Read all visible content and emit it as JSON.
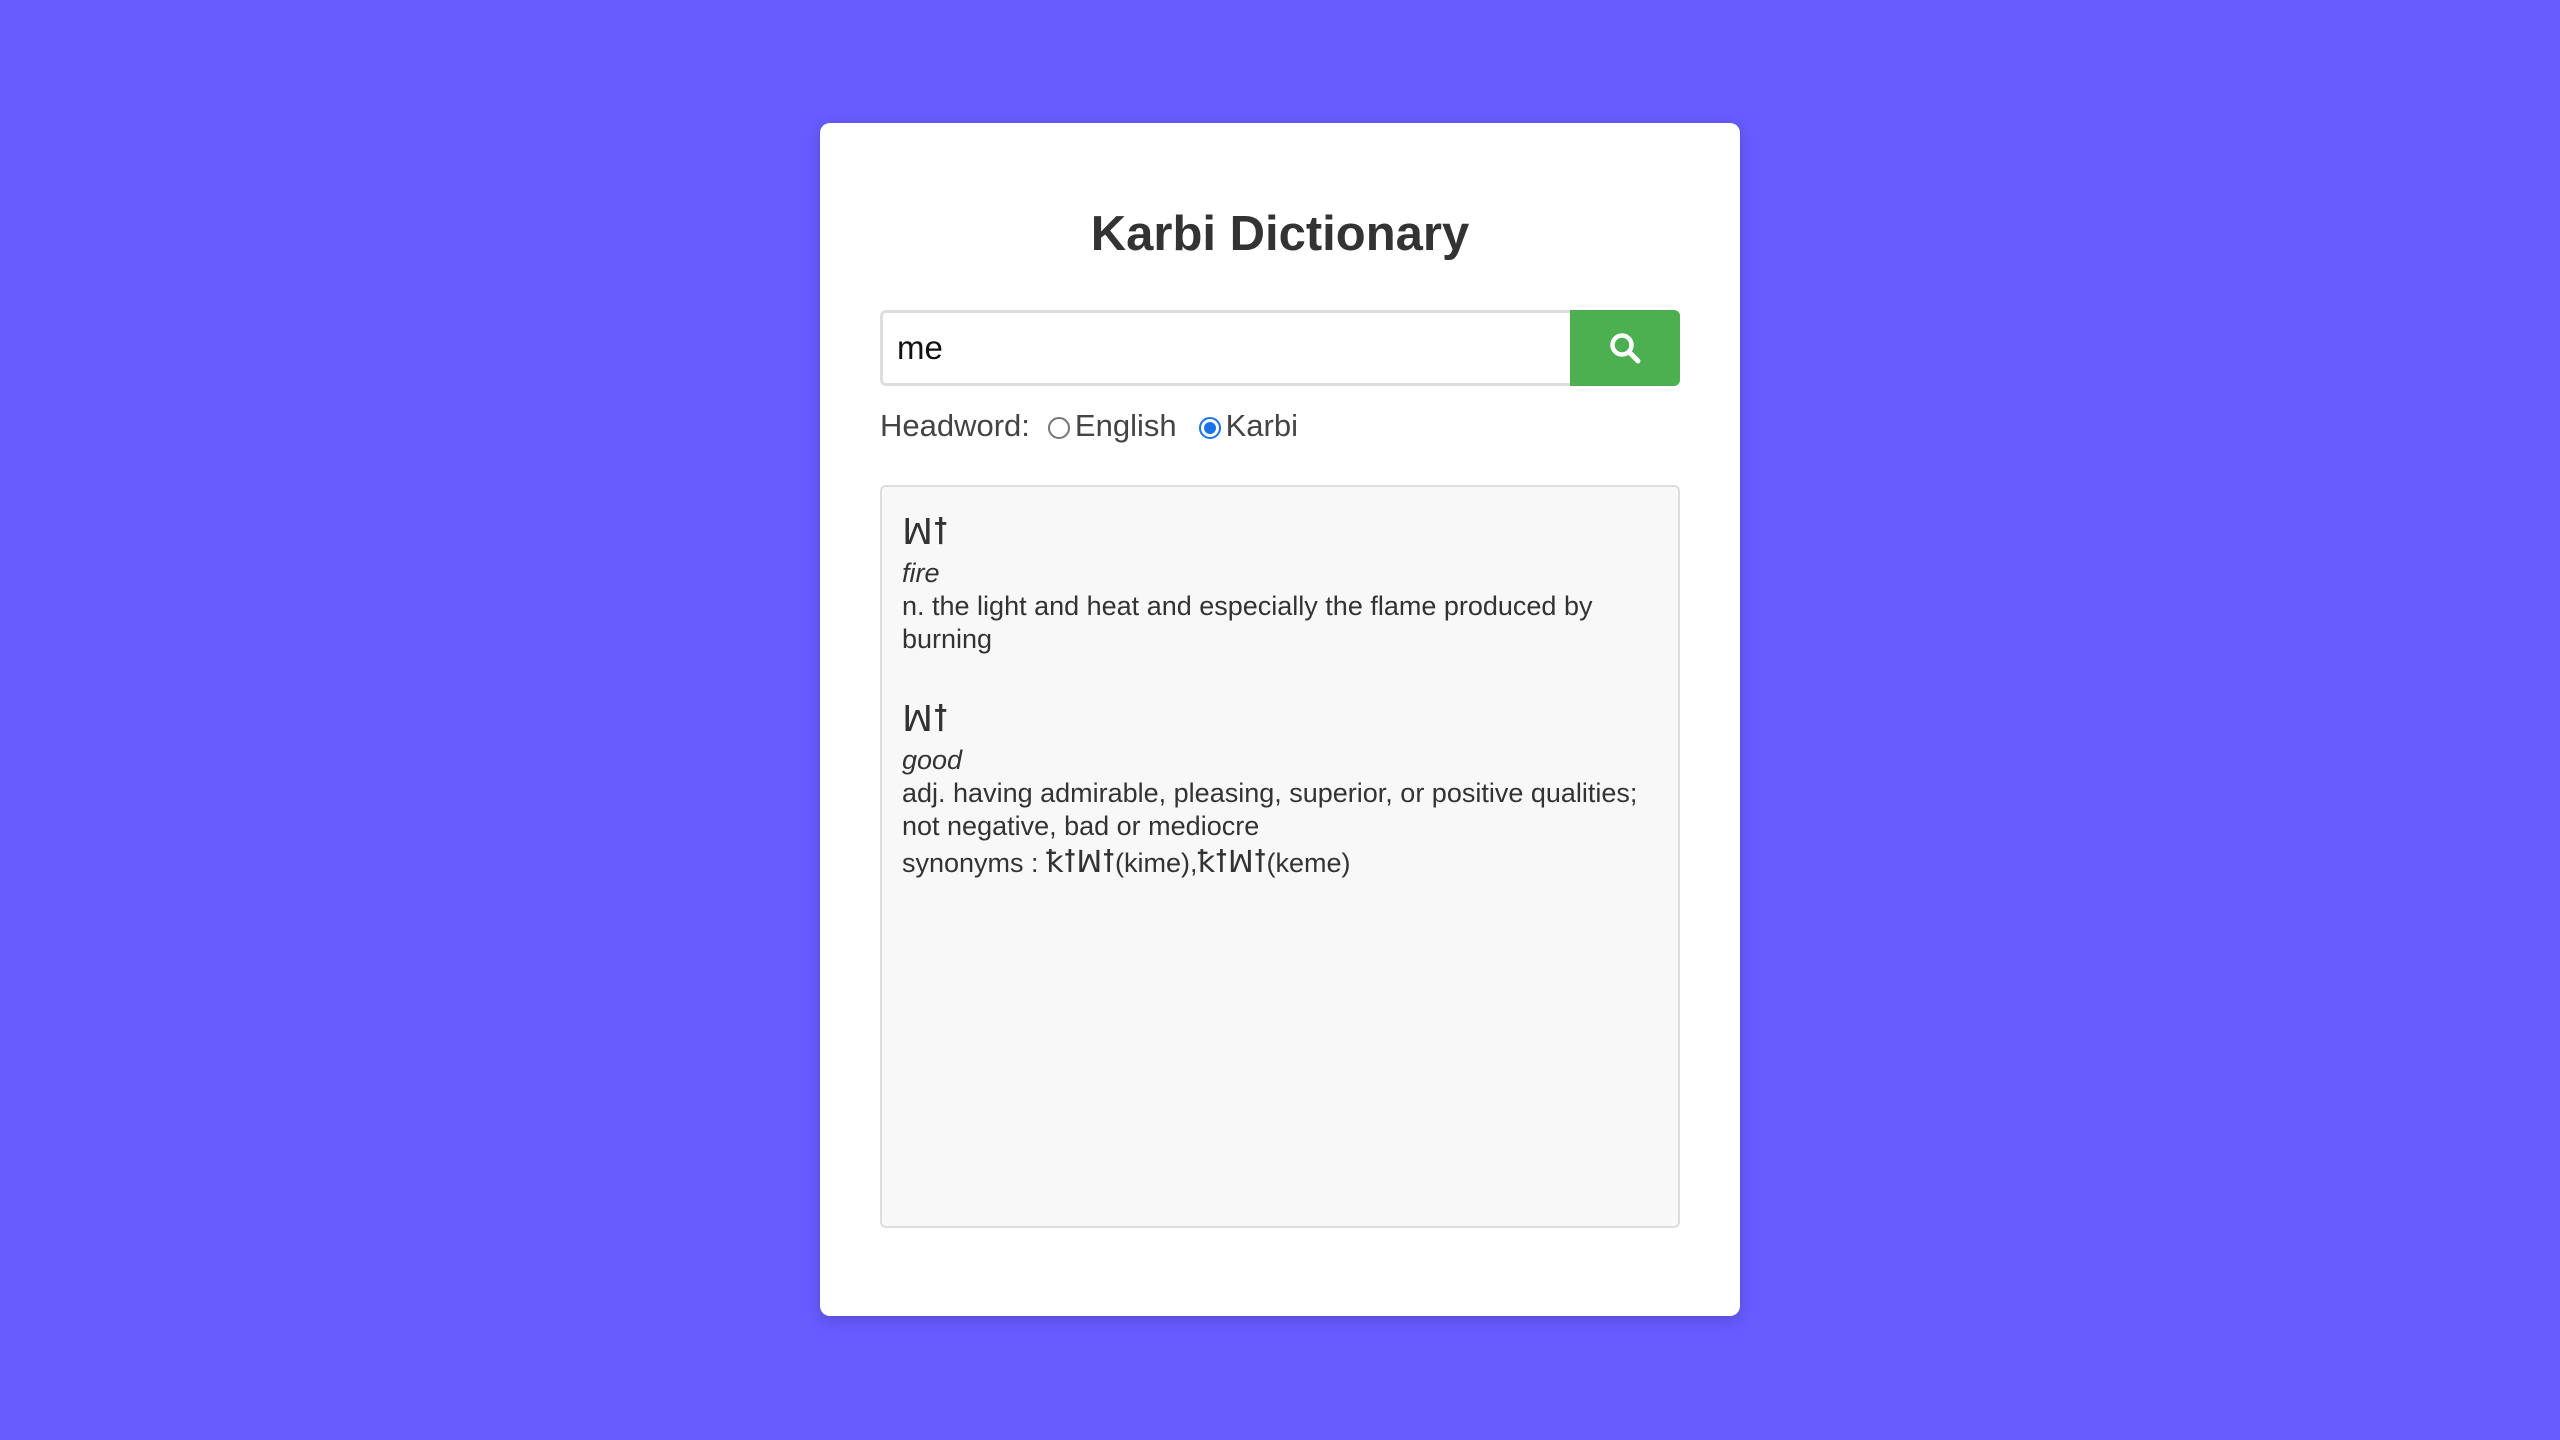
{
  "app": {
    "title": "Karbi Dictionary",
    "colors": {
      "background": "#675cff",
      "card": "#ffffff",
      "accent": "#4caf50",
      "radio_selected": "#1a73e8",
      "results_bg": "#f8f8f8"
    }
  },
  "search": {
    "value": "me",
    "button_icon": "search-icon"
  },
  "headword": {
    "label": "Headword:",
    "options": [
      {
        "label": "English",
        "selected": false
      },
      {
        "label": "Karbi",
        "selected": true
      }
    ]
  },
  "results": [
    {
      "headword": "ꟽꝉ",
      "gloss": "fire",
      "definition": "n. the light and heat and especially the flame produced by burning"
    },
    {
      "headword": "ꟽꝉ",
      "gloss": "good",
      "definition": "adj. having admirable, pleasing, superior, or positive qualities; not negative, bad or mediocre",
      "synonyms_label": "synonyms :",
      "synonyms": [
        {
          "script": "ꝁꝉꟽꝉ",
          "latin": "(kime)",
          "separator": ","
        },
        {
          "script": "ꝁꝉꟽꝉ",
          "latin": "(keme)",
          "separator": ""
        }
      ]
    }
  ]
}
